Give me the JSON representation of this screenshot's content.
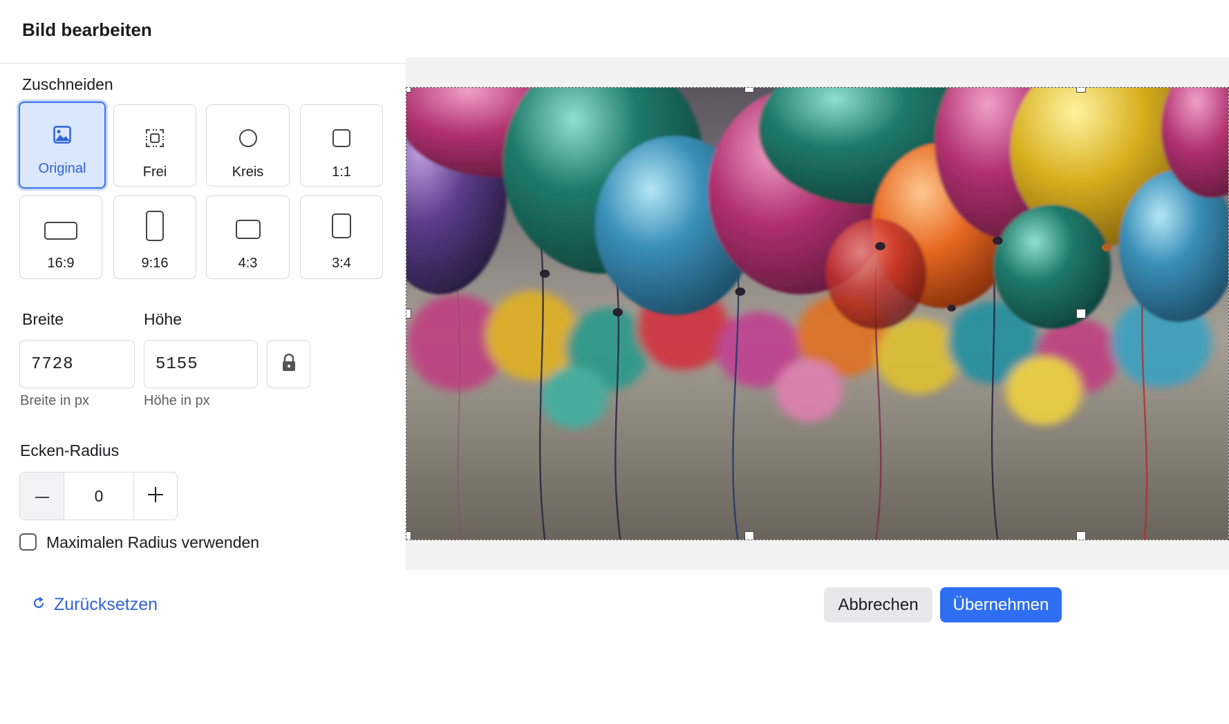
{
  "dialog": {
    "title": "Bild bearbeiten"
  },
  "crop": {
    "section_label": "Zuschneiden",
    "options": [
      {
        "label": "Original",
        "icon": "image-icon",
        "selected": true
      },
      {
        "label": "Frei",
        "icon": "free-crop-icon",
        "selected": false
      },
      {
        "label": "Kreis",
        "icon": "circle-icon",
        "selected": false
      },
      {
        "label": "1:1",
        "icon": "square-icon",
        "selected": false
      },
      {
        "label": "16:9",
        "icon": "landscape-wide-icon",
        "selected": false
      },
      {
        "label": "9:16",
        "icon": "portrait-tall-icon",
        "selected": false
      },
      {
        "label": "4:3",
        "icon": "landscape-icon",
        "selected": false
      },
      {
        "label": "3:4",
        "icon": "portrait-icon",
        "selected": false
      }
    ]
  },
  "dimensions": {
    "width_label": "Breite",
    "height_label": "Höhe",
    "width_value": "7728",
    "height_value": "5155",
    "width_hint": "Breite in px",
    "height_hint": "Höhe in px",
    "lock_icon": "lock-icon"
  },
  "corner_radius": {
    "label": "Ecken-Radius",
    "value": "0",
    "max_radius_label": "Maximalen Radius verwenden",
    "max_radius_checked": false
  },
  "footer": {
    "reset_label": "Zurücksetzen",
    "cancel_label": "Abbrechen",
    "apply_label": "Übernehmen"
  },
  "colors": {
    "accent": "#2e6ff1",
    "selected_bg": "#dbe7fd",
    "link": "#2f63d8"
  }
}
